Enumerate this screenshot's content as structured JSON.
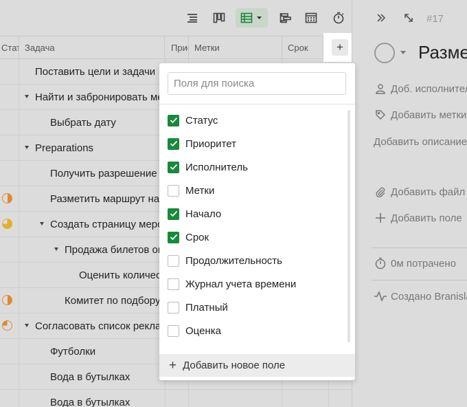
{
  "toolbar": {
    "icons": [
      "list-view-icon",
      "board-view-icon",
      "table-view-icon",
      "timeline-view-icon",
      "calendar-view-icon",
      "timer-icon"
    ],
    "colors": {
      "active_bg": "#c9d6c9",
      "table_icon_green": "#178a3c"
    }
  },
  "table": {
    "headers": {
      "status": "Статус",
      "task": "Задача",
      "priority": "Приоритет",
      "tags": "Метки",
      "deadline": "Срок"
    },
    "rows": [
      {
        "task": "Поставить цели и задачи",
        "level": 1,
        "expandable": false,
        "status": ""
      },
      {
        "task": "Найти и забронировать место",
        "level": 1,
        "expandable": true,
        "status": ""
      },
      {
        "task": "Выбрать дату",
        "level": 2,
        "expandable": false,
        "status": ""
      },
      {
        "task": "Preparations",
        "level": 1,
        "expandable": true,
        "status": ""
      },
      {
        "task": "Получить разрешение",
        "level": 2,
        "expandable": false,
        "status": ""
      },
      {
        "task": "Разметить маршрут на карте",
        "level": 2,
        "expandable": false,
        "status": "half"
      },
      {
        "task": "Создать страницу мероприятия",
        "level": 2,
        "expandable": true,
        "status": "three-quarter"
      },
      {
        "task": "Продажа билетов онлайн",
        "level": 3,
        "expandable": true,
        "status": ""
      },
      {
        "task": "Оценить количество",
        "level": 4,
        "expandable": false,
        "status": ""
      },
      {
        "task": "Комитет по подбору",
        "level": 3,
        "expandable": false,
        "status": "half"
      },
      {
        "task": "Согласовать список рекламы",
        "level": 1,
        "expandable": true,
        "status": "quarter"
      },
      {
        "task": "Футболки",
        "level": 2,
        "expandable": false,
        "status": ""
      },
      {
        "task": "Вода в бутылках",
        "level": 2,
        "expandable": false,
        "status": ""
      },
      {
        "task": "Вода в бутылках",
        "level": 2,
        "expandable": false,
        "status": ""
      }
    ],
    "add_column_label": "+"
  },
  "dropdown": {
    "search_placeholder": "Поля для поиска",
    "fields": [
      {
        "label": "Статус",
        "checked": true
      },
      {
        "label": "Приоритет",
        "checked": true
      },
      {
        "label": "Исполнитель",
        "checked": true
      },
      {
        "label": "Метки",
        "checked": false
      },
      {
        "label": "Начало",
        "checked": true
      },
      {
        "label": "Срок",
        "checked": true
      },
      {
        "label": "Продолжительность",
        "checked": false
      },
      {
        "label": "Журнал учета времени",
        "checked": false
      },
      {
        "label": "Платный",
        "checked": false
      },
      {
        "label": "Оценка",
        "checked": false
      }
    ],
    "add_field_label": "Добавить новое поле",
    "colors": {
      "checked": "#178a3c"
    }
  },
  "panel": {
    "ticket": "#17",
    "title": "Разметить маршрут на карте",
    "add_assignee": "Доб. исполнителя",
    "add_tags": "Добавить метки",
    "add_description": "Добавить описание",
    "add_file": "Добавить файл",
    "add_field": "Добавить поле",
    "time_spent": "0м потрачено",
    "created_by": "Создано Branislav"
  }
}
